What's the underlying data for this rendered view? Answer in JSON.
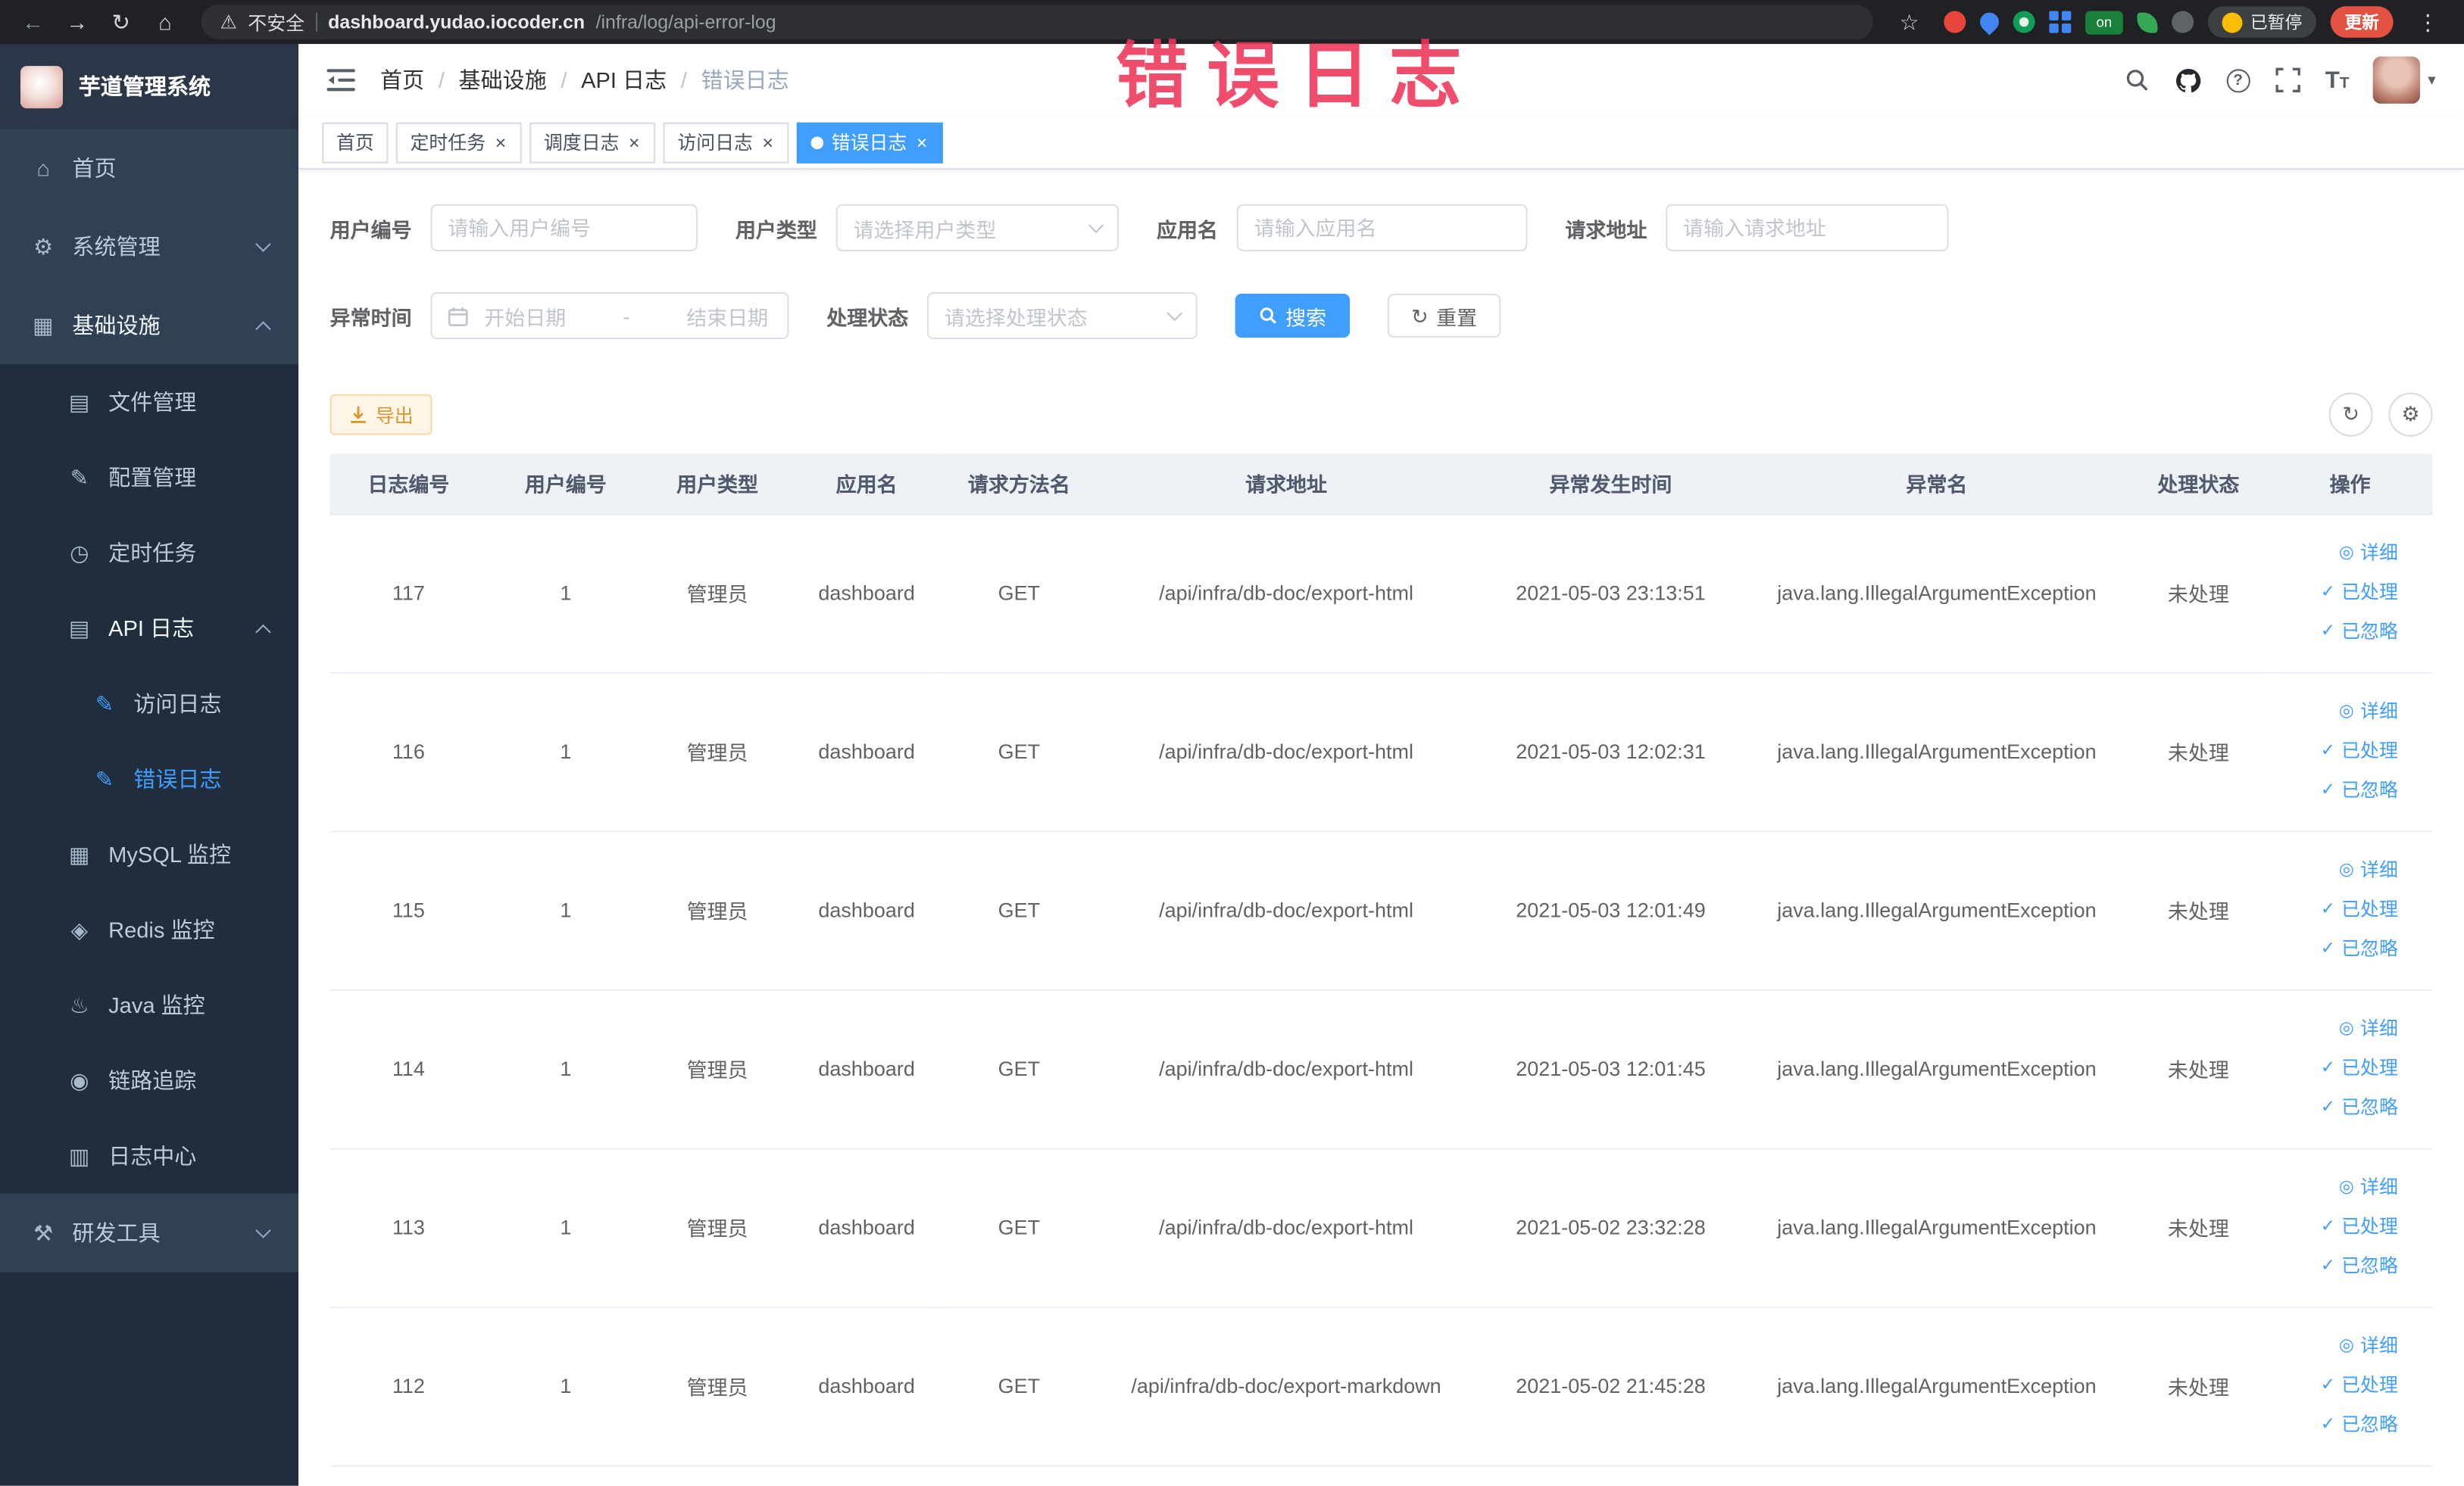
{
  "browser": {
    "security_label": "不安全",
    "url_host": "dashboard.yudao.iocoder.cn",
    "url_path": "/infra/log/api-error-log",
    "on_badge": "on",
    "paused_badge": "已暂停",
    "update_button": "更新"
  },
  "overlay": {
    "title": "错误日志"
  },
  "sidebar": {
    "logo_title": "芋道管理系统",
    "home": "首页",
    "system_mgmt": "系统管理",
    "infrastructure": "基础设施",
    "file_mgmt": "文件管理",
    "config_mgmt": "配置管理",
    "scheduled_jobs": "定时任务",
    "api_log": "API 日志",
    "access_log": "访问日志",
    "error_log": "错误日志",
    "mysql_monitor": "MySQL 监控",
    "redis_monitor": "Redis 监控",
    "java_monitor": "Java 监控",
    "link_trace": "链路追踪",
    "log_center": "日志中心",
    "dev_tools": "研发工具"
  },
  "breadcrumb": {
    "separator": "/",
    "items": [
      {
        "label": "首页"
      },
      {
        "label": "基础设施"
      },
      {
        "label": "API 日志"
      },
      {
        "label": "错误日志"
      }
    ]
  },
  "tabs": {
    "items": [
      {
        "label": "首页"
      },
      {
        "label": "定时任务"
      },
      {
        "label": "调度日志"
      },
      {
        "label": "访问日志"
      },
      {
        "label": "错误日志"
      }
    ]
  },
  "filters": {
    "user_id": {
      "label": "用户编号",
      "placeholder": "请输入用户编号"
    },
    "user_type": {
      "label": "用户类型",
      "placeholder": "请选择用户类型"
    },
    "app_name": {
      "label": "应用名",
      "placeholder": "请输入应用名"
    },
    "request_url": {
      "label": "请求地址",
      "placeholder": "请输入请求地址"
    },
    "exception_time": {
      "label": "异常时间",
      "start_placeholder": "开始日期",
      "separator": "-",
      "end_placeholder": "结束日期"
    },
    "process_status": {
      "label": "处理状态",
      "placeholder": "请选择处理状态"
    },
    "search_button": "搜索",
    "reset_button": "重置"
  },
  "toolbar": {
    "export_button": "导出"
  },
  "table": {
    "columns": [
      "日志编号",
      "用户编号",
      "用户类型",
      "应用名",
      "请求方法名",
      "请求地址",
      "异常发生时间",
      "异常名",
      "处理状态",
      "操作"
    ],
    "actions": {
      "detail": "详细",
      "processed": "已处理",
      "ignored": "已忽略"
    },
    "rows": [
      {
        "id": "117",
        "user_id": "1",
        "user_type": "管理员",
        "app": "dashboard",
        "method": "GET",
        "url": "/api/infra/db-doc/export-html",
        "time": "2021-05-03 23:13:51",
        "exception": "java.lang.IllegalArgumentException",
        "status": "未处理"
      },
      {
        "id": "116",
        "user_id": "1",
        "user_type": "管理员",
        "app": "dashboard",
        "method": "GET",
        "url": "/api/infra/db-doc/export-html",
        "time": "2021-05-03 12:02:31",
        "exception": "java.lang.IllegalArgumentException",
        "status": "未处理"
      },
      {
        "id": "115",
        "user_id": "1",
        "user_type": "管理员",
        "app": "dashboard",
        "method": "GET",
        "url": "/api/infra/db-doc/export-html",
        "time": "2021-05-03 12:01:49",
        "exception": "java.lang.IllegalArgumentException",
        "status": "未处理"
      },
      {
        "id": "114",
        "user_id": "1",
        "user_type": "管理员",
        "app": "dashboard",
        "method": "GET",
        "url": "/api/infra/db-doc/export-html",
        "time": "2021-05-03 12:01:45",
        "exception": "java.lang.IllegalArgumentException",
        "status": "未处理"
      },
      {
        "id": "113",
        "user_id": "1",
        "user_type": "管理员",
        "app": "dashboard",
        "method": "GET",
        "url": "/api/infra/db-doc/export-html",
        "time": "2021-05-02 23:32:28",
        "exception": "java.lang.IllegalArgumentException",
        "status": "未处理"
      },
      {
        "id": "112",
        "user_id": "1",
        "user_type": "管理员",
        "app": "dashboard",
        "method": "GET",
        "url": "/api/infra/db-doc/export-markdown",
        "time": "2021-05-02 21:45:28",
        "exception": "java.lang.IllegalArgumentException",
        "status": "未处理"
      }
    ]
  },
  "icons": {
    "back": "←",
    "forward": "→",
    "reload": "↻",
    "home": "⌂",
    "warning": "⚠",
    "star": "☆",
    "kebab": "⋮",
    "caret_down": "▾",
    "close": "×",
    "question": "?",
    "refresh": "↻",
    "gear": "⚙",
    "check": "✓",
    "eye": "◎",
    "font_large": "T",
    "font_small": "T",
    "sidebar_home": "⌂",
    "sidebar_system": "⚙",
    "sidebar_infra": "▦",
    "sidebar_file": "▤",
    "sidebar_config": "✎",
    "sidebar_job": "◷",
    "sidebar_api": "▤",
    "sidebar_access": "✎",
    "sidebar_error": "✎",
    "sidebar_mysql": "▦",
    "sidebar_redis": "◈",
    "sidebar_java": "♨",
    "sidebar_trace": "◉",
    "sidebar_log": "▥",
    "sidebar_tools": "⚒"
  },
  "colors": {
    "primary": "#409eff",
    "sidebar_bg": "#304156",
    "submenu_bg": "#1f2d3d",
    "overlay_red": "#ee3558",
    "warning_button_text": "#d9972f",
    "table_header_bg": "#eef1f6"
  }
}
